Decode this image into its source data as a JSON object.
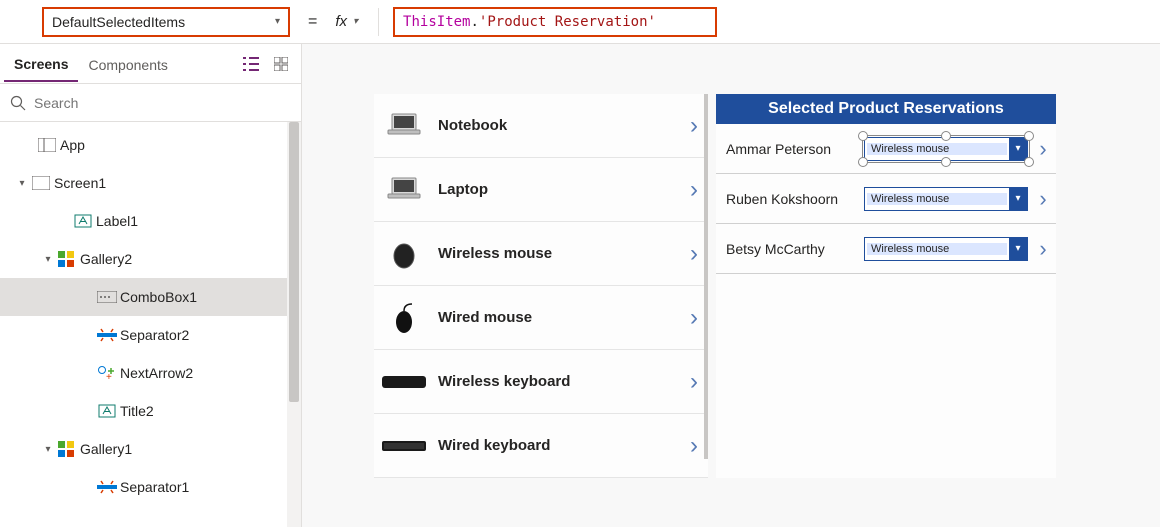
{
  "formula": {
    "property": "DefaultSelectedItems",
    "fx_label": "fx",
    "token_object": "ThisItem",
    "token_dot": ".",
    "token_field": "'Product Reservation'"
  },
  "panel": {
    "tabs": {
      "screens": "Screens",
      "components": "Components"
    },
    "search_placeholder": "Search",
    "tree": [
      {
        "label": "App",
        "indent": 20,
        "caret": "",
        "icon": "app"
      },
      {
        "label": "Screen1",
        "indent": 14,
        "caret": "▾",
        "icon": "screen"
      },
      {
        "label": "Label1",
        "indent": 56,
        "caret": "",
        "icon": "label"
      },
      {
        "label": "Gallery2",
        "indent": 40,
        "caret": "▾",
        "icon": "gallery"
      },
      {
        "label": "ComboBox1",
        "indent": 80,
        "caret": "",
        "icon": "combobox",
        "selected": true
      },
      {
        "label": "Separator2",
        "indent": 80,
        "caret": "",
        "icon": "separator"
      },
      {
        "label": "NextArrow2",
        "indent": 80,
        "caret": "",
        "icon": "nextarrow"
      },
      {
        "label": "Title2",
        "indent": 80,
        "caret": "",
        "icon": "label"
      },
      {
        "label": "Gallery1",
        "indent": 40,
        "caret": "▾",
        "icon": "gallery"
      },
      {
        "label": "Separator1",
        "indent": 80,
        "caret": "",
        "icon": "separator"
      }
    ]
  },
  "gallery1": {
    "items": [
      {
        "title": "Notebook",
        "icon": "notebook"
      },
      {
        "title": "Laptop",
        "icon": "laptop"
      },
      {
        "title": "Wireless mouse",
        "icon": "mouse"
      },
      {
        "title": "Wired mouse",
        "icon": "mouse2"
      },
      {
        "title": "Wireless keyboard",
        "icon": "keyboard"
      },
      {
        "title": "Wired keyboard",
        "icon": "keyboard2"
      }
    ]
  },
  "gallery2": {
    "header": "Selected Product Reservations",
    "rows": [
      {
        "name": "Ammar Peterson",
        "value": "Wireless mouse",
        "selected": true
      },
      {
        "name": "Ruben Kokshoorn",
        "value": "Wireless mouse",
        "selected": false
      },
      {
        "name": "Betsy McCarthy",
        "value": "Wireless mouse",
        "selected": false
      }
    ]
  }
}
